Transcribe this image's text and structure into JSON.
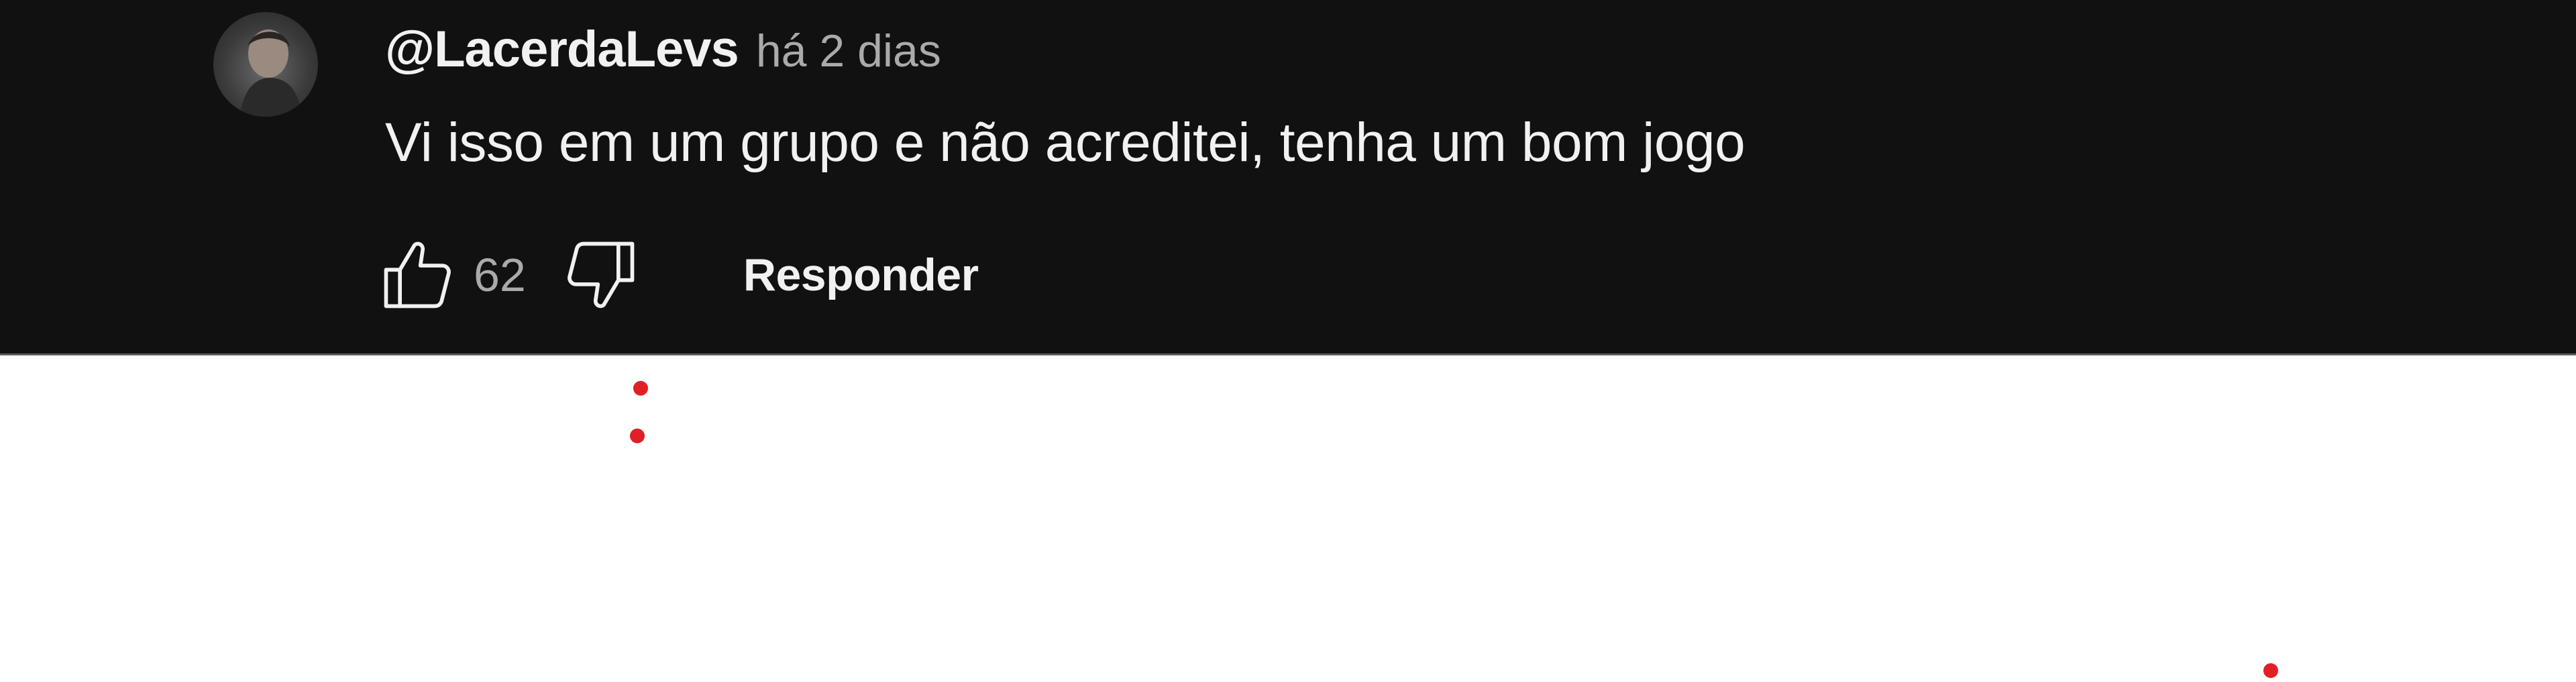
{
  "comment": {
    "author": "@LacerdaLevs",
    "timestamp": "há 2 dias",
    "text": "Vi isso em um grupo e não acreditei, tenha um bom jogo",
    "like_count": "62",
    "reply_label": "Responder"
  },
  "icons": {
    "avatar": "user-avatar",
    "like": "thumbs-up-icon",
    "dislike": "thumbs-down-icon"
  },
  "colors": {
    "panel_background": "#111111",
    "primary_text": "#f1f1f1",
    "secondary_text": "#aaaaaa",
    "marker_dot": "#e01f26"
  }
}
